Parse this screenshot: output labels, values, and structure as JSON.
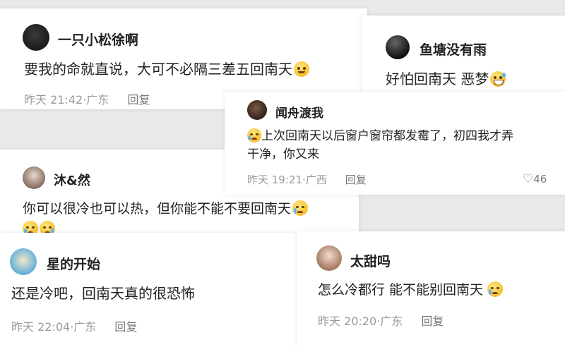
{
  "comments": [
    {
      "username": "一只小松徐啊",
      "text": "要我的命就直说，大可不必隔三差五回南天",
      "emoji": "smiling-emoji",
      "time": "昨天 21:42",
      "location": "广东",
      "reply": "回复"
    },
    {
      "username": "鱼塘没有雨",
      "text": "好怕回南天 恶梦",
      "emoji": "grinning-sweat-emoji",
      "time": "",
      "location": "",
      "reply": ""
    },
    {
      "username": "闻舟渡我",
      "text_line1": "上次回南天以后窗户窗帘都发霉了，初四我才弄",
      "text_line2": "干净，你又来",
      "emoji": "crying-emoji",
      "time": "昨天 19:21",
      "location": "广西",
      "reply": "回复",
      "likes": "46"
    },
    {
      "username": "沐&然",
      "text": "你可以很冷也可以热，但你能不能不要回南天",
      "emoji": "crying-emoji",
      "time": "",
      "location": "",
      "reply": ""
    },
    {
      "username": "星的开始",
      "text": "还是冷吧，回南天真的很恐怖",
      "time": "昨天 22:04",
      "location": "广东",
      "reply": "回复"
    },
    {
      "username": "太甜吗",
      "text": "怎么冷都行 能不能别回南天",
      "emoji": "crying-emoji",
      "time": "昨天 20:20",
      "location": "广东",
      "reply": "回复"
    }
  ],
  "separator": "·",
  "colors": {
    "background": "#e9e9ec",
    "meta": "#9a9a9a",
    "emoji": "#f6c12e"
  }
}
